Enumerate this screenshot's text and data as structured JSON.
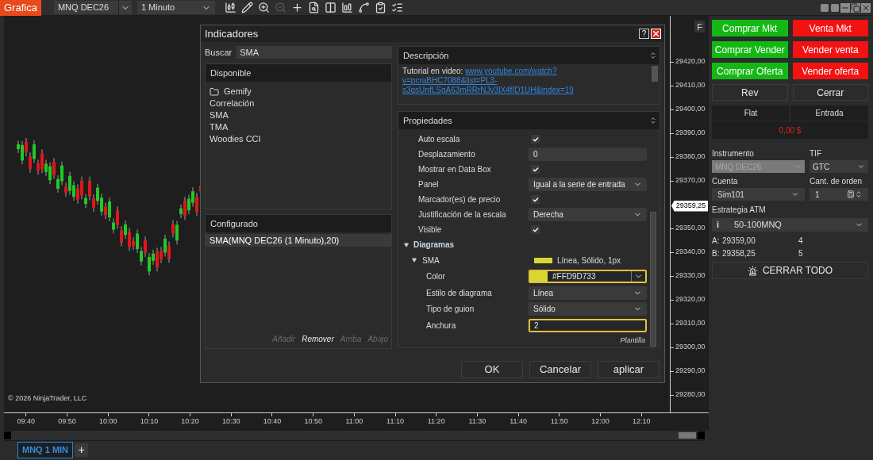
{
  "toolbar": {
    "app_button": "Grafica",
    "instrument": "MNQ DEC26",
    "interval": "1 Minuto",
    "tools": [
      {
        "kind": "bars",
        "disabled": false
      },
      {
        "kind": "pencil",
        "disabled": false
      },
      {
        "kind": "zoom_in",
        "disabled": false
      },
      {
        "kind": "zoom_out",
        "disabled": true
      },
      {
        "kind": "crosshair",
        "disabled": false
      },
      {
        "kind": "data_box",
        "disabled": false
      },
      {
        "kind": "panel",
        "disabled": false
      },
      {
        "kind": "columns",
        "disabled": false
      },
      {
        "kind": "line",
        "disabled": false
      },
      {
        "kind": "strategy",
        "disabled": false
      },
      {
        "kind": "list",
        "disabled": false
      }
    ]
  },
  "chart": {
    "copyright": "© 2026 NinjaTrader, LLC",
    "scale_button": "F",
    "price_axis": [
      {
        "kind": "tick",
        "label": "29420,00"
      },
      {
        "kind": "tick",
        "label": "29410,00"
      },
      {
        "kind": "tick",
        "label": "29400,00"
      },
      {
        "kind": "tick",
        "label": "29390,00"
      },
      {
        "kind": "tick",
        "label": "29380,00"
      },
      {
        "kind": "tick",
        "label": "29370,00"
      },
      {
        "kind": "current",
        "label": "29359,25"
      },
      {
        "kind": "tick",
        "label": "29350,00"
      },
      {
        "kind": "tick",
        "label": "29340,00"
      },
      {
        "kind": "tick",
        "label": "29330,00"
      },
      {
        "kind": "tick",
        "label": "29320,00"
      },
      {
        "kind": "tick",
        "label": "29310,00"
      },
      {
        "kind": "tick",
        "label": "29300,00"
      },
      {
        "kind": "tick",
        "label": "29290,00"
      },
      {
        "kind": "tick",
        "label": "29280,00"
      }
    ],
    "time_labels": [
      "09:40",
      "09:50",
      "10:00",
      "10:10",
      "10:20",
      "10:30",
      "10:40",
      "10:50",
      "11:00",
      "11:10",
      "11:20",
      "11:30",
      "11:40",
      "11:50",
      "12:00",
      "12:10"
    ]
  },
  "dialog": {
    "title": "Indicadores",
    "help": "?",
    "search_label": "Buscar",
    "search_value": "SMA",
    "available_title": "Disponible",
    "available": [
      {
        "kind": "folder",
        "label": "Gemify"
      },
      {
        "kind": "indicator",
        "label": "Correlación"
      },
      {
        "kind": "indicator",
        "label": "SMA"
      },
      {
        "kind": "indicator",
        "label": "TMA"
      },
      {
        "kind": "indicator",
        "label": "Woodies CCI"
      }
    ],
    "configured_title": "Configurado",
    "configured": [
      {
        "label": "SMA(MNQ DEC26 (1 Minuto),20)",
        "selected": true
      }
    ],
    "list_actions": [
      {
        "label": "Añadir",
        "disabled": true
      },
      {
        "label": "Remover",
        "disabled": false
      },
      {
        "label": "Arriba",
        "disabled": true
      },
      {
        "label": "Abajo",
        "disabled": true
      }
    ],
    "description_title": "Descripción",
    "description_label": "Tutorial en video:",
    "description_link": "www.youtube.com/watch?v=pcraBHC7088&list=PL3-s3qsUnfLSgA63mRRrNJv3lX4fID1UH&index=19",
    "properties_title": "Propiedades",
    "properties": [
      {
        "kind": "check",
        "label": "Auto escala",
        "checked": true
      },
      {
        "kind": "text",
        "label": "Desplazamiento",
        "value": "0",
        "highlighted": false
      },
      {
        "kind": "check",
        "label": "Mostrar en Data Box",
        "checked": true
      },
      {
        "kind": "select",
        "label": "Panel",
        "value": "Igual a la serie de entrada",
        "highlighted": false
      },
      {
        "kind": "check",
        "label": "Marcador(es) de precio",
        "checked": true
      },
      {
        "kind": "select",
        "label": "Justificación de la escala",
        "value": "Derecha",
        "highlighted": false
      },
      {
        "kind": "check",
        "label": "Visible",
        "checked": true
      },
      {
        "kind": "group",
        "label": "Diagramas",
        "expanded": true,
        "children": [
          {
            "kind": "plot",
            "label": "SMA",
            "expanded": true,
            "color": "#d9d733",
            "summary": "Línea, Sólido, 1px",
            "children": [
              {
                "kind": "color",
                "label": "Color",
                "value": "#FFD9D733",
                "color": "#d9d733",
                "highlighted": true
              },
              {
                "kind": "select",
                "label": "Estilo de diagrama",
                "value": "Línea",
                "highlighted": false
              },
              {
                "kind": "select",
                "label": "Tipo de guion",
                "value": "Sólido",
                "highlighted": false
              },
              {
                "kind": "text",
                "label": "Anchura",
                "value": "2",
                "highlighted": true
              }
            ]
          }
        ]
      }
    ],
    "template_link": "Plantilla",
    "buttons": [
      "OK",
      "Cancelar",
      "aplicar"
    ]
  },
  "chart_tabs": [
    {
      "label": "MNQ 1 MIN",
      "selected": true
    }
  ],
  "add_tab": "+",
  "order_panel": {
    "buttons": [
      {
        "label": "Comprar Mkt",
        "kind": "buy"
      },
      {
        "label": "Venta Mkt",
        "kind": "sell"
      },
      {
        "label": "Comprar Vender",
        "kind": "buy"
      },
      {
        "label": "Vender venta",
        "kind": "sell"
      },
      {
        "label": "Comprar Oferta",
        "kind": "buy"
      },
      {
        "label": "Vender oferta",
        "kind": "sell"
      },
      {
        "label": "Rev",
        "kind": "neutral"
      },
      {
        "label": "Cerrar",
        "kind": "neutral"
      }
    ],
    "position": {
      "state": "Flat",
      "entry_label": "Entrada",
      "pnl": "0,00 $"
    },
    "instrument": {
      "label": "Instrumento",
      "value": "MNQ DEC26",
      "disabled": true
    },
    "tif": {
      "label": "TIF",
      "value": "GTC",
      "disabled": false
    },
    "account": {
      "label": "Cuenta",
      "value": "Sim101",
      "disabled": false
    },
    "quantity": {
      "label": "Cant. de orden",
      "value": "1"
    },
    "atm": {
      "label": "Estrategia ATM",
      "info": "i",
      "value": "50-100MNQ"
    },
    "quotes": [
      {
        "side": "A:",
        "price": "29359,00",
        "size": "4"
      },
      {
        "side": "B:",
        "price": "29358,25",
        "size": "5"
      }
    ],
    "close_all": "CERRAR TODO"
  }
}
